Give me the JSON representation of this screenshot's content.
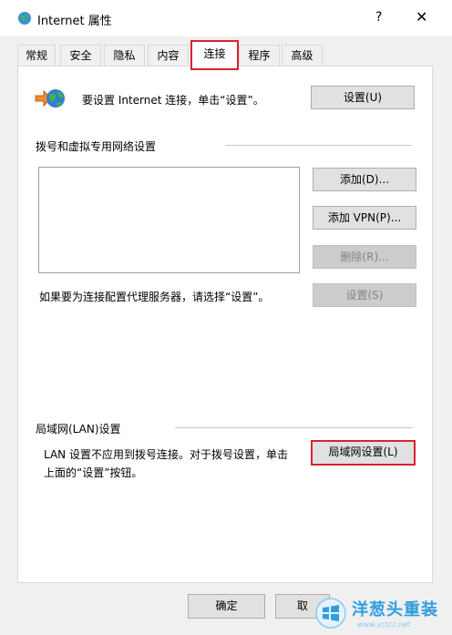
{
  "window": {
    "title": "Internet 属性",
    "help": "?",
    "close": "✕"
  },
  "tabs": [
    "常规",
    "安全",
    "隐私",
    "内容",
    "连接",
    "程序",
    "高级"
  ],
  "setup": {
    "text": "要设置 Internet 连接，单击“设置”。",
    "button": "设置(U)"
  },
  "dialup": {
    "heading": "拨号和虚拟专用网络设置",
    "add": "添加(D)...",
    "add_vpn": "添加 VPN(P)...",
    "remove": "删除(R)...",
    "settings": "设置(S)",
    "proxy_text": "如果要为连接配置代理服务器，请选择“设置”。"
  },
  "lan": {
    "heading": "局域网(LAN)设置",
    "text_line1": "LAN 设置不应用到拨号连接。对于拨号设置，单击",
    "text_line2": "上面的“设置”按钮。",
    "button": "局域网设置(L)"
  },
  "footer": {
    "ok": "确定",
    "cancel": "取"
  },
  "watermark": {
    "text": "洋葱头重装",
    "sub": "www.yctcz.net"
  },
  "colors": {
    "highlight": "#d9232e",
    "watermark": "#2f9de0"
  }
}
